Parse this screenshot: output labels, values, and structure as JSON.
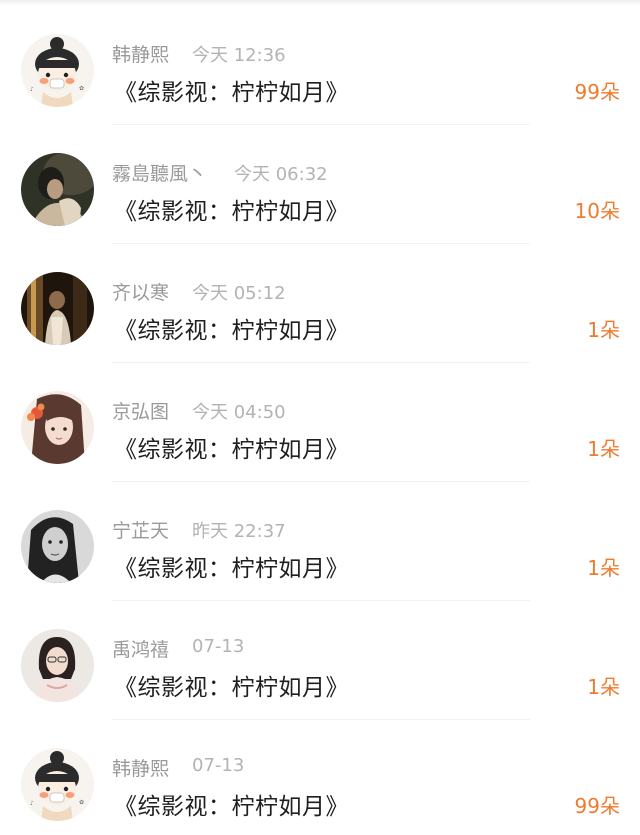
{
  "accent_color": "#f07a2e",
  "entries": [
    {
      "user": "韩静熙",
      "time": "今天 12:36",
      "title": "《综影视：柠柠如月》",
      "count": "99朵",
      "avatar": "cartoon-girl-avatar-icon"
    },
    {
      "user": "霧島聽風丶",
      "time": "今天 06:32",
      "title": "《综影视：柠柠如月》",
      "count": "10朵",
      "avatar": "photo-avatar-icon"
    },
    {
      "user": "齐以寒",
      "time": "今天 05:12",
      "title": "《综影视：柠柠如月》",
      "count": "1朵",
      "avatar": "photo-avatar-icon"
    },
    {
      "user": "京弘图",
      "time": "今天 04:50",
      "title": "《综影视：柠柠如月》",
      "count": "1朵",
      "avatar": "illustrated-girl-avatar-icon"
    },
    {
      "user": "宁芷天",
      "time": "昨天 22:37",
      "title": "《综影视：柠柠如月》",
      "count": "1朵",
      "avatar": "bw-photo-avatar-icon"
    },
    {
      "user": "禹鸿禧",
      "time": "07-13",
      "title": "《综影视：柠柠如月》",
      "count": "1朵",
      "avatar": "photo-avatar-icon"
    },
    {
      "user": "韩静熙",
      "time": "07-13",
      "title": "《综影视：柠柠如月》",
      "count": "99朵",
      "avatar": "cartoon-girl-avatar-icon"
    }
  ]
}
